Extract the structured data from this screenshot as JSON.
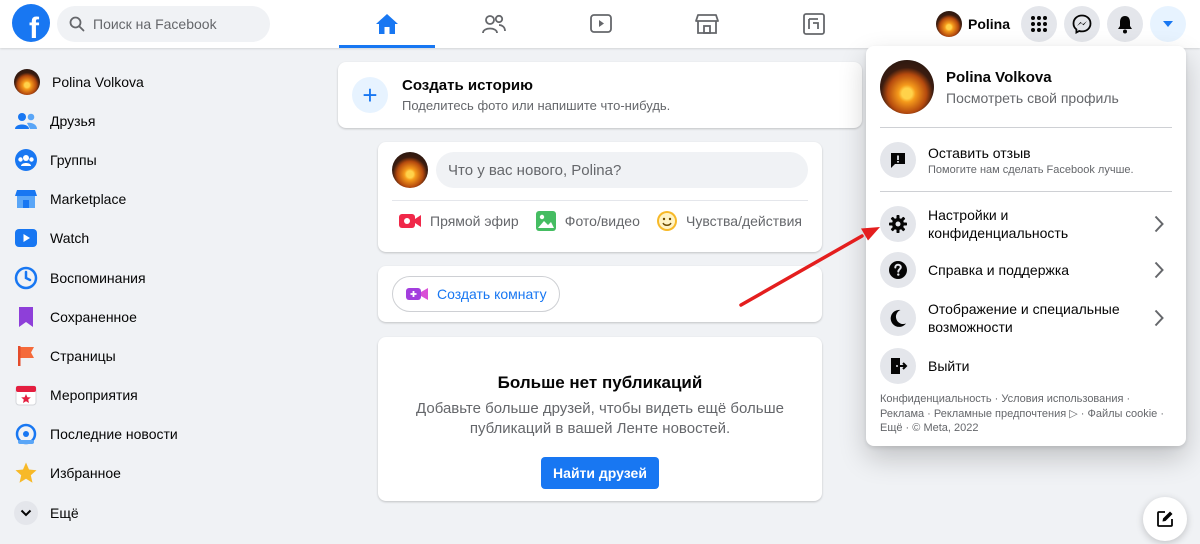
{
  "header": {
    "logo": "f",
    "search_placeholder": "Поиск на Facebook",
    "profile_name": "Polina"
  },
  "sidebar": {
    "items": [
      {
        "label": "Polina Volkova",
        "icon": "avatar"
      },
      {
        "label": "Друзья",
        "icon": "friends-icon"
      },
      {
        "label": "Группы",
        "icon": "groups-icon"
      },
      {
        "label": "Marketplace",
        "icon": "marketplace-icon"
      },
      {
        "label": "Watch",
        "icon": "watch-icon"
      },
      {
        "label": "Воспоминания",
        "icon": "memories-icon"
      },
      {
        "label": "Сохраненное",
        "icon": "saved-icon"
      },
      {
        "label": "Страницы",
        "icon": "pages-icon"
      },
      {
        "label": "Мероприятия",
        "icon": "events-icon"
      },
      {
        "label": "Последние новости",
        "icon": "recent-news-icon"
      },
      {
        "label": "Избранное",
        "icon": "favorites-icon"
      },
      {
        "label": "Ещё",
        "icon": "chevron-down-icon"
      }
    ]
  },
  "story": {
    "title": "Создать историю",
    "subtitle": "Поделитесь фото или напишите что-нибудь."
  },
  "composer": {
    "placeholder": "Что у вас нового, Polina?",
    "actions": [
      "Прямой эфир",
      "Фото/видео",
      "Чувства/действия"
    ]
  },
  "room": {
    "label": "Создать комнату"
  },
  "empty_feed": {
    "title": "Больше нет публикаций",
    "text": "Добавьте больше друзей, чтобы видеть ещё больше публикаций в вашей Ленте новостей.",
    "button": "Найти друзей"
  },
  "menu": {
    "profile_name": "Polina Volkova",
    "profile_sub": "Посмотреть свой профиль",
    "feedback_title": "Оставить отзыв",
    "feedback_sub": "Помогите нам сделать Facebook лучше.",
    "items": [
      {
        "label": "Настройки и конфиденциальность",
        "icon": "gear-icon"
      },
      {
        "label": "Справка и поддержка",
        "icon": "help-icon"
      },
      {
        "label": "Отображение и специальные возможности",
        "icon": "moon-icon"
      },
      {
        "label": "Выйти",
        "icon": "logout-icon"
      }
    ],
    "footer": {
      "line1": "Конфиденциальность · Условия использования ·",
      "line2": "Реклама · Рекламные предпочтения ▷ · Файлы cookie ·",
      "line3": "Ещё · © Meta, 2022"
    }
  },
  "colors": {
    "accent": "#1877f2",
    "background": "#f0f2f5",
    "arrow": "#e41e1e"
  }
}
